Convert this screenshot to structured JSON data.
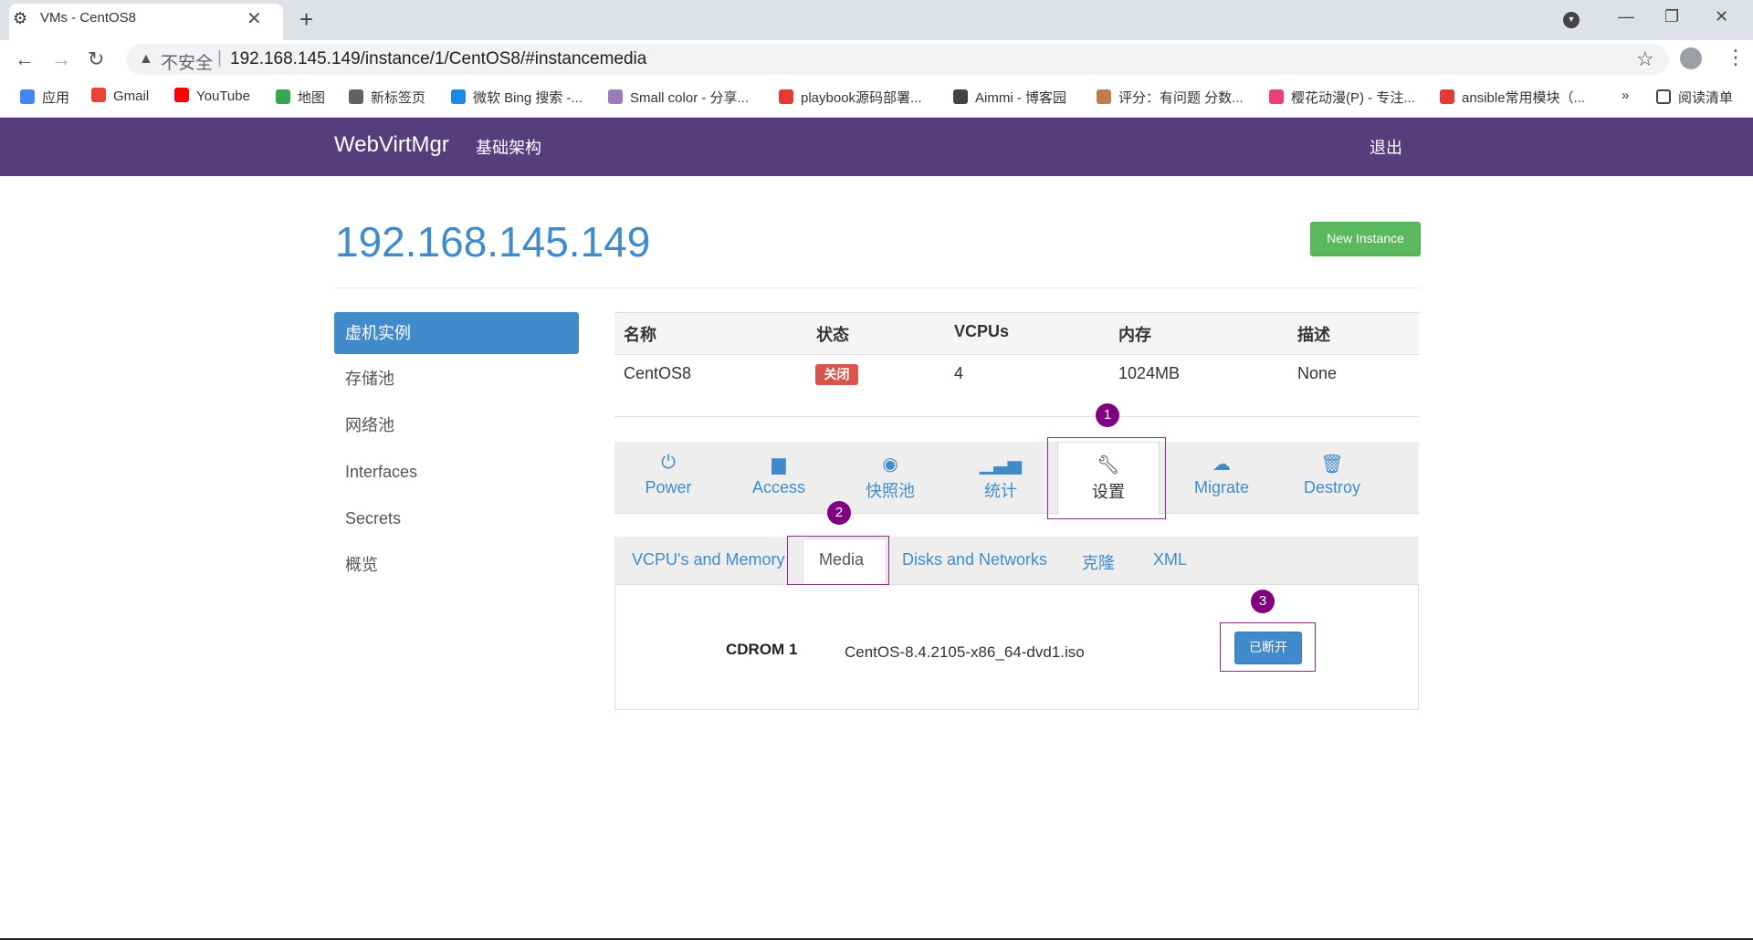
{
  "browser": {
    "tab_title": "VMs - CentOS8",
    "insecure_label": "不安全",
    "url": "192.168.145.149/instance/1/CentOS8/#instancemedia",
    "bookmarks": [
      {
        "label": "应用",
        "color": "#4285f4"
      },
      {
        "label": "Gmail",
        "color": "#ea4335"
      },
      {
        "label": "YouTube",
        "color": "#ff0000"
      },
      {
        "label": "地图",
        "color": "#34a853"
      },
      {
        "label": "新标签页",
        "color": "#5f6368"
      },
      {
        "label": "微软 Bing 搜索 -...",
        "color": "#1e88e5"
      },
      {
        "label": "Small color - 分享...",
        "color": "#9c7cb8"
      },
      {
        "label": "playbook源码部署...",
        "color": "#e53935"
      },
      {
        "label": "Aimmi - 博客园",
        "color": "#444444"
      },
      {
        "label": "评分：有问题 分数...",
        "color": "#c27c4a"
      },
      {
        "label": "樱花动漫(P) - 专注...",
        "color": "#ec407a"
      },
      {
        "label": "ansible常用模块（...",
        "color": "#e53935"
      }
    ],
    "more_bookmarks": "»",
    "reading_list": "阅读清单"
  },
  "app": {
    "brand": "WebVirtMgr",
    "nav_infra": "基础架构",
    "nav_logout": "退出",
    "page_title": "192.168.145.149",
    "new_instance": "New Instance",
    "sidebar": [
      "虚机实例",
      "存储池",
      "网络池",
      "Interfaces",
      "Secrets",
      "概览"
    ],
    "table": {
      "headers": [
        "名称",
        "状态",
        "VCPUs",
        "内存",
        "描述"
      ],
      "row": {
        "name": "CentOS8",
        "status": "关闭",
        "vcpus": "4",
        "memory": "1024MB",
        "description": "None"
      }
    },
    "actions": [
      {
        "label": "Power",
        "icon": "power-icon"
      },
      {
        "label": "Access",
        "icon": "briefcase-icon"
      },
      {
        "label": "快照池",
        "icon": "camera-icon"
      },
      {
        "label": "统计",
        "icon": "stats-icon"
      },
      {
        "label": "设置",
        "icon": "wrench-icon"
      },
      {
        "label": "Migrate",
        "icon": "cloud-upload-icon"
      },
      {
        "label": "Destroy",
        "icon": "trash-icon"
      }
    ],
    "subtabs": [
      "VCPU's and Memory",
      "Media",
      "Disks and Networks",
      "克隆",
      "XML"
    ],
    "media": {
      "cdrom_label": "CDROM 1",
      "cdrom_value": "CentOS-8.4.2105-x86_64-dvd1.iso",
      "disconnect": "已断开"
    },
    "markers": [
      "1",
      "2",
      "3"
    ],
    "colors": {
      "brand_bar": "#563d7c",
      "primary": "#428bca",
      "success": "#5cb85c",
      "danger": "#d9534f",
      "marker": "#800080"
    }
  }
}
